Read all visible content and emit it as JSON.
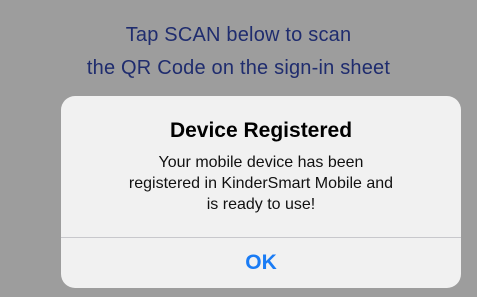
{
  "background_prompt": {
    "line1": "Tap SCAN below to scan",
    "line2": "the QR Code on the sign-in sheet"
  },
  "alert": {
    "title": "Device Registered",
    "message_line1": "Your mobile device has been",
    "message_line2": "registered in KinderSmart Mobile and",
    "message_line3": "is ready to use!",
    "ok_label": "OK"
  },
  "colors": {
    "dim_overlay": "#9d9d9d",
    "prompt_text": "#1f2c6e",
    "alert_background": "#f1f1f1",
    "button_accent": "#1a7cf5"
  }
}
